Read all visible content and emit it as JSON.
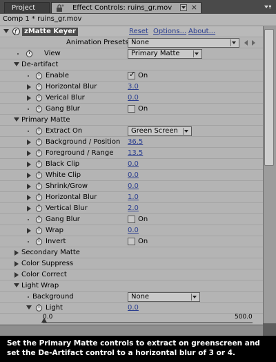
{
  "tabs": {
    "project": "Project",
    "effect_controls": "Effect Controls: ruins_gr.mov"
  },
  "panel_header": "Comp 1 * ruins_gr.mov",
  "effect": {
    "name": "zMatte Keyer",
    "reset": "Reset",
    "options": "Options...",
    "about": "About...",
    "presets_label": "Animation Presets:",
    "presets_value": "None"
  },
  "rows": {
    "view": {
      "label": "View",
      "value": "Primary Matte"
    },
    "deartifact": {
      "label": "De-artifact"
    },
    "enable": {
      "label": "Enable",
      "value": "On"
    },
    "dh_blur": {
      "label": "Horizontal Blur",
      "value": "3.0"
    },
    "dv_blur": {
      "label": "Verical Blur",
      "value": "0.0"
    },
    "d_gang": {
      "label": "Gang Blur",
      "value": "On"
    },
    "primary": {
      "label": "Primary Matte"
    },
    "extract": {
      "label": "Extract On",
      "value": "Green Screen"
    },
    "bg_pos": {
      "label": "Background / Position",
      "value": "36.5"
    },
    "fg_range": {
      "label": "Foreground / Range",
      "value": "13.5"
    },
    "black_clip": {
      "label": "Black Clip",
      "value": "0.0"
    },
    "white_clip": {
      "label": "White Clip",
      "value": "0.0"
    },
    "shrink": {
      "label": "Shrink/Grow",
      "value": "0.0"
    },
    "ph_blur": {
      "label": "Horizontal Blur",
      "value": "1.0"
    },
    "pv_blur": {
      "label": "Vertical Blur",
      "value": "2.0"
    },
    "p_gang": {
      "label": "Gang Blur",
      "value": "On"
    },
    "wrap": {
      "label": "Wrap",
      "value": "0.0"
    },
    "invert": {
      "label": "Invert",
      "value": "On"
    },
    "secondary": {
      "label": "Secondary Matte"
    },
    "color_suppress": {
      "label": "Color Suppress"
    },
    "color_correct": {
      "label": "Color Correct"
    },
    "light_wrap": {
      "label": "Light Wrap"
    },
    "background": {
      "label": "Background",
      "value": "None"
    },
    "light": {
      "label": "Light",
      "value": "0.0"
    },
    "slider": {
      "min": "0.0",
      "max": "500.0",
      "level": 0.0
    }
  },
  "caption": "Set the Primary Matte controls to extract on greenscreen and set the De-Artifact control to a horizontal blur of 3 or 4.",
  "colors": {
    "panel": "#b4b4b4",
    "link": "#2a3d8f",
    "caption_bg": "#000000"
  }
}
